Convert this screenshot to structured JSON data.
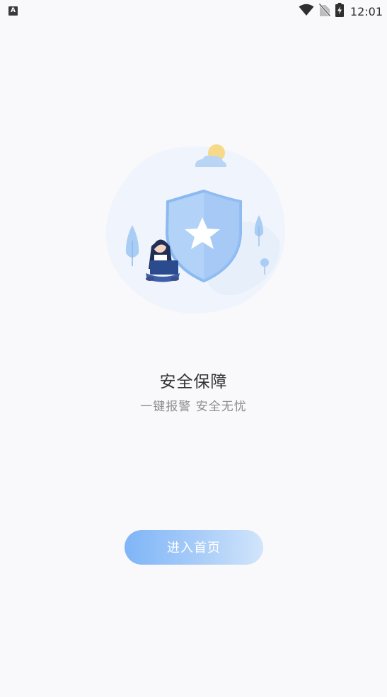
{
  "status_bar": {
    "notification_badge": "A",
    "time": "12:01",
    "icons": [
      "wifi-icon",
      "no-sim-icon",
      "battery-charging-icon"
    ]
  },
  "illustration": {
    "icon": "shield-star-icon",
    "colors": {
      "shield": "#9cc3f5",
      "shield_border": "#7aaef0",
      "sun": "#f7d98a",
      "tree": "#a9cdf5"
    }
  },
  "content": {
    "title": "安全保障",
    "subtitle": "一键报警 安全无忧"
  },
  "actions": {
    "enter_home_label": "进入首页"
  },
  "colors": {
    "background": "#f9f9fb",
    "button_gradient_start": "#7fb5f7",
    "button_gradient_end": "#d2e5fb"
  }
}
